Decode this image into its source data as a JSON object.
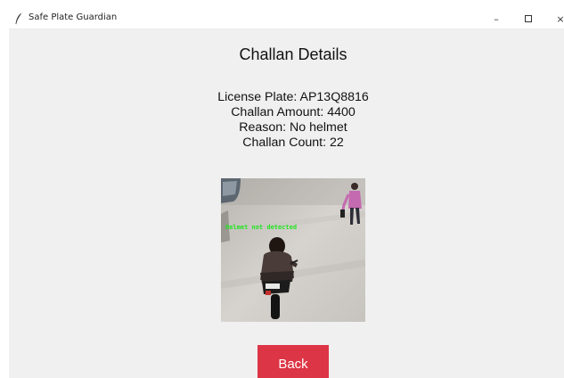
{
  "window": {
    "title": "Safe Plate Guardian",
    "controls": {
      "minimize": "–",
      "close": "×"
    }
  },
  "heading": "Challan Details",
  "details": {
    "license_plate": "License Plate: AP13Q8816",
    "challan_amount": "Challan Amount: 4400",
    "reason": "Reason: No helmet",
    "challan_count": "Challan Count: 22"
  },
  "photo": {
    "overlay_label": "Helmet not detected"
  },
  "back_button_label": "Back",
  "colors": {
    "window_bg": "#f0f0f0",
    "back_button": "#dc3545",
    "overlay_text": "#1fe61f"
  },
  "icons": {
    "app": "feather-icon",
    "minimize": "minimize-icon",
    "maximize": "maximize-icon",
    "close": "close-icon"
  }
}
